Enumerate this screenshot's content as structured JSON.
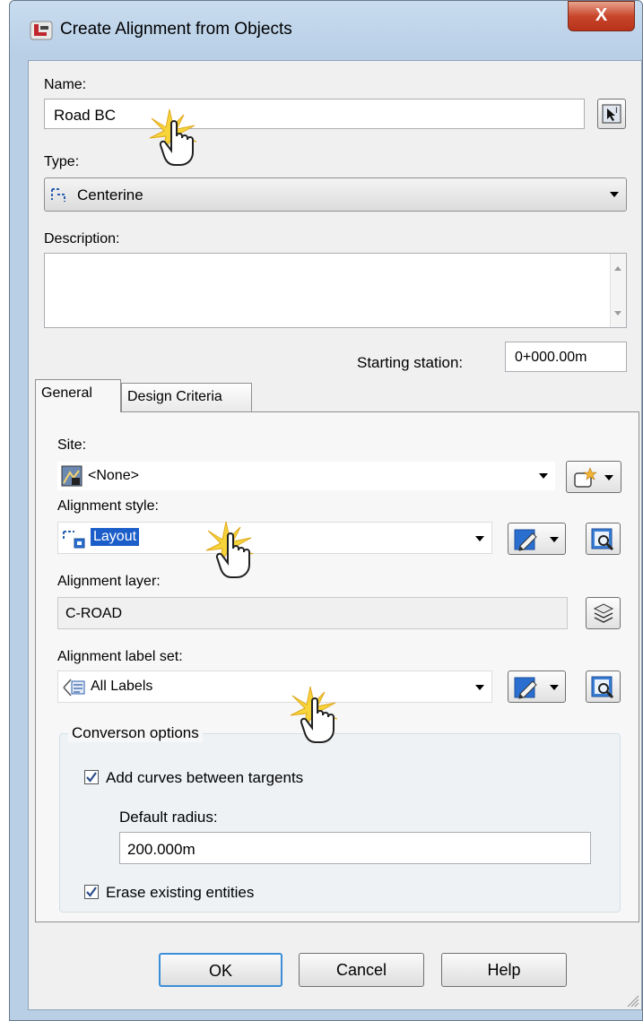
{
  "window": {
    "title": "Create Alignment from Objects",
    "close_glyph": "X"
  },
  "name": {
    "label": "Name:",
    "value": "Road BC"
  },
  "type": {
    "label": "Type:",
    "value": "Centerine"
  },
  "description": {
    "label": "Description:",
    "value": ""
  },
  "starting_station": {
    "label": "Starting station:",
    "value": "0+000.00m"
  },
  "tabs": [
    {
      "label": "General"
    },
    {
      "label": "Design Criteria"
    }
  ],
  "general": {
    "site": {
      "label": "Site:",
      "value": "<None>"
    },
    "alignment_style": {
      "label": "Alignment style:",
      "value": "Layout"
    },
    "alignment_layer": {
      "label": "Alignment layer:",
      "value": "C-ROAD"
    },
    "alignment_label_set": {
      "label": "Alignment label set:",
      "value": "All Labels"
    }
  },
  "conversion": {
    "group_label": "Converson options",
    "add_curves": {
      "label": "Add curves between targents",
      "checked": true
    },
    "default_radius": {
      "label": "Default radius:",
      "value": "200.000m"
    },
    "erase": {
      "label": "Erase existing entities",
      "checked": true
    }
  },
  "buttons": {
    "ok": "OK",
    "cancel": "Cancel",
    "help": "Help"
  },
  "colors": {
    "accent": "#3399ff",
    "close": "#c8462b",
    "highlight": "#1b5ec9"
  }
}
